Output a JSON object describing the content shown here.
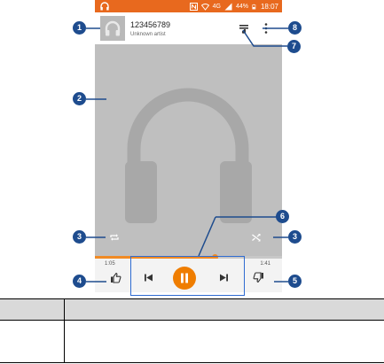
{
  "status_bar": {
    "time": "18:07",
    "battery": "44%",
    "network": "4G",
    "icons": [
      "headphones-icon",
      "nfc-icon",
      "wifi-icon",
      "signal-icon",
      "battery-icon"
    ]
  },
  "now_playing": {
    "title": "123456789",
    "artist": "Unknown artist"
  },
  "playback": {
    "elapsed": "1:05",
    "total": "1:41",
    "progress_fraction": 0.64
  },
  "callouts": {
    "c1": "1",
    "c2": "2",
    "c3a": "3",
    "c3b": "3",
    "c4": "4",
    "c5": "5",
    "c6": "6",
    "c7": "7",
    "c8": "8"
  },
  "colors": {
    "status_bar": "#e8691e",
    "accent": "#ef7d00",
    "callout": "#1e4c8e",
    "highlight": "#2e6bd1",
    "album_art": "#bfbfbf"
  }
}
